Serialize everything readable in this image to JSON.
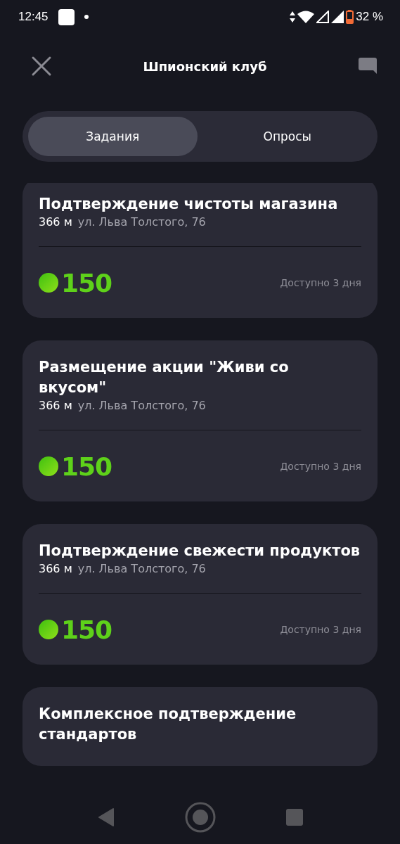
{
  "status_bar": {
    "time": "12:45",
    "battery": "32 %"
  },
  "header": {
    "title": "Шпионский клуб"
  },
  "tabs": [
    {
      "label": "Задания",
      "selected": true
    },
    {
      "label": "Опросы",
      "selected": false
    }
  ],
  "tasks": [
    {
      "title": "Подтверждение чистоты магазина",
      "distance": "366 м",
      "address": "ул. Льва Толстого, 76",
      "points": "150",
      "availability": "Доступно 3 дня"
    },
    {
      "title": "Размещение акции \"Живи со вкусом\"",
      "distance": "366 м",
      "address": "ул. Льва Толстого, 76",
      "points": "150",
      "availability": "Доступно 3 дня"
    },
    {
      "title": "Подтверждение свежести продуктов",
      "distance": "366 м",
      "address": "ул. Льва Толстого, 76",
      "points": "150",
      "availability": "Доступно 3 дня"
    },
    {
      "title": "Комплексное подтверждение стандартов"
    }
  ]
}
